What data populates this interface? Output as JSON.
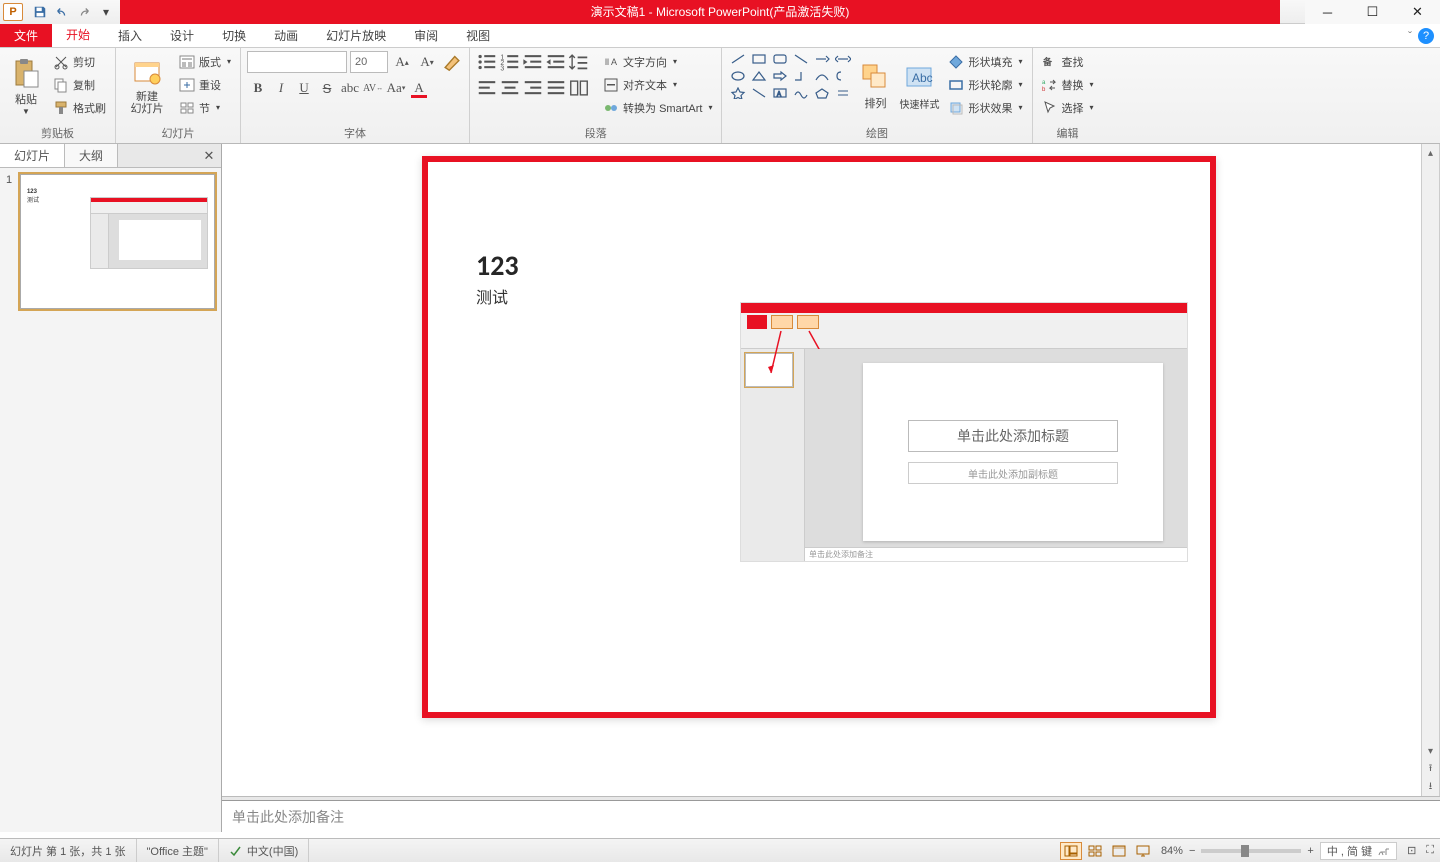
{
  "titlebar": {
    "title": "演示文稿1 - Microsoft PowerPoint(产品激活失败)",
    "app_letter": "P"
  },
  "ribbon_tabs": {
    "file": "文件",
    "tabs": [
      "开始",
      "插入",
      "设计",
      "切换",
      "动画",
      "幻灯片放映",
      "审阅",
      "视图"
    ]
  },
  "ribbon": {
    "clipboard": {
      "paste": "粘贴",
      "cut": "剪切",
      "copy": "复制",
      "format_painter": "格式刷",
      "label": "剪贴板"
    },
    "slides": {
      "new_slide": "新建\n幻灯片",
      "layout": "版式",
      "reset": "重设",
      "section": "节",
      "label": "幻灯片"
    },
    "font": {
      "size": "20",
      "label": "字体"
    },
    "paragraph": {
      "text_direction": "文字方向",
      "align_text": "对齐文本",
      "convert_smartart": "转换为 SmartArt",
      "label": "段落"
    },
    "drawing": {
      "arrange": "排列",
      "quick_styles": "快速样式",
      "shape_fill": "形状填充",
      "shape_outline": "形状轮廓",
      "shape_effects": "形状效果",
      "label": "绘图"
    },
    "editing": {
      "find": "查找",
      "replace": "替换",
      "select": "选择",
      "label": "编辑"
    }
  },
  "left_pane": {
    "tab_slides": "幻灯片",
    "tab_outline": "大纲",
    "slide_number": "1",
    "thumb_text1": "123",
    "thumb_text2": "测试"
  },
  "slide_content": {
    "line1": "123",
    "line2": "测试",
    "embed_title": "单击此处添加标题",
    "embed_subtitle": "单击此处添加副标题",
    "embed_notes": "单击此处添加备注"
  },
  "notes_placeholder": "单击此处添加备注",
  "statusbar": {
    "slide_info": "幻灯片 第 1 张，共 1 张",
    "theme": "\"Office 主题\"",
    "language": "中文(中国)",
    "zoom": "84%",
    "ime": "中 , 简 键"
  }
}
